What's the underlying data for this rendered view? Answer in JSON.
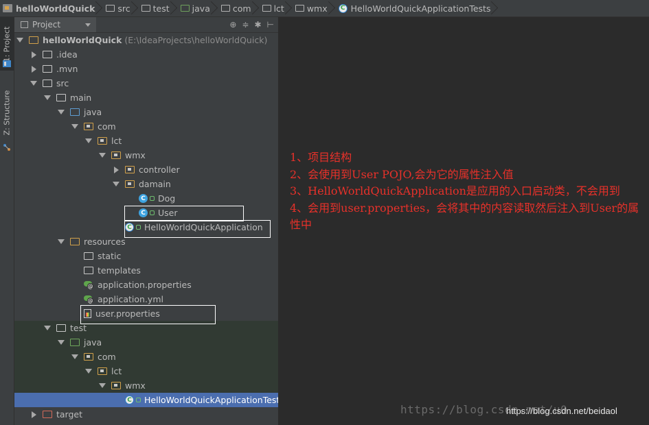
{
  "breadcrumbs": [
    "helloWorldQuick",
    "src",
    "test",
    "java",
    "com",
    "lct",
    "wmx",
    "HelloWorldQuickApplicationTests"
  ],
  "tool_windows": {
    "project_tab": "1: Project",
    "structure_tab": "Z: Structure"
  },
  "panel": {
    "title": "Project",
    "tool_icons": [
      "target-icon",
      "collapse-icon",
      "gear-icon",
      "hide-icon"
    ]
  },
  "tree": [
    {
      "label": "helloWorldQuick",
      "suffix": "(E:\\IdeaProjects\\helloWorldQuick)",
      "indent": 0,
      "arrow": "down",
      "icon": "project-folder-icon"
    },
    {
      "label": ".idea",
      "indent": 1,
      "arrow": "right",
      "icon": "folder-icon"
    },
    {
      "label": ".mvn",
      "indent": 1,
      "arrow": "right",
      "icon": "folder-icon"
    },
    {
      "label": "src",
      "indent": 1,
      "arrow": "down",
      "icon": "folder-icon"
    },
    {
      "label": "main",
      "indent": 2,
      "arrow": "down",
      "icon": "folder-icon"
    },
    {
      "label": "java",
      "indent": 3,
      "arrow": "down",
      "icon": "source-folder-icon"
    },
    {
      "label": "com",
      "indent": 4,
      "arrow": "down",
      "icon": "package-icon"
    },
    {
      "label": "lct",
      "indent": 5,
      "arrow": "down",
      "icon": "package-icon"
    },
    {
      "label": "wmx",
      "indent": 6,
      "arrow": "down",
      "icon": "package-icon"
    },
    {
      "label": "controller",
      "indent": 7,
      "arrow": "right",
      "icon": "package-icon"
    },
    {
      "label": "damain",
      "indent": 7,
      "arrow": "down",
      "icon": "package-icon"
    },
    {
      "label": "Dog",
      "indent": 8,
      "arrow": "none",
      "icon": "class-icon"
    },
    {
      "label": "User",
      "indent": 8,
      "arrow": "none",
      "icon": "class-icon"
    },
    {
      "label": "HelloWorldQuickApplication",
      "indent": 7,
      "arrow": "none",
      "icon": "spring-boot-class-icon"
    },
    {
      "label": "resources",
      "indent": 3,
      "arrow": "down",
      "icon": "resources-folder-icon"
    },
    {
      "label": "static",
      "indent": 4,
      "arrow": "none",
      "icon": "folder-icon"
    },
    {
      "label": "templates",
      "indent": 4,
      "arrow": "none",
      "icon": "folder-icon"
    },
    {
      "label": "application.properties",
      "indent": 4,
      "arrow": "none",
      "icon": "spring-config-icon"
    },
    {
      "label": "application.yml",
      "indent": 4,
      "arrow": "none",
      "icon": "spring-config-icon"
    },
    {
      "label": "user.properties",
      "indent": 4,
      "arrow": "none",
      "icon": "properties-file-icon"
    },
    {
      "label": "test",
      "indent": 2,
      "arrow": "down",
      "icon": "folder-icon"
    },
    {
      "label": "java",
      "indent": 3,
      "arrow": "down",
      "icon": "test-folder-icon"
    },
    {
      "label": "com",
      "indent": 4,
      "arrow": "down",
      "icon": "package-icon"
    },
    {
      "label": "lct",
      "indent": 5,
      "arrow": "down",
      "icon": "package-icon"
    },
    {
      "label": "wmx",
      "indent": 6,
      "arrow": "down",
      "icon": "package-icon"
    },
    {
      "label": "HelloWorldQuickApplicationTests",
      "indent": 7,
      "arrow": "none",
      "icon": "spring-boot-test-icon",
      "selected": true
    },
    {
      "label": "target",
      "indent": 1,
      "arrow": "right",
      "icon": "excluded-folder-icon"
    }
  ],
  "notes": [
    "1、项目结构",
    "2、会使用到User POJO,会为它的属性注入值",
    "3、HelloWorldQuickApplication是应用的入口启动类，不会用到",
    "4、会用到user.properties，会将其中的内容读取然后注入到User的属性中"
  ],
  "watermark": "https://blog.csdn.net/u0",
  "watermark_overlay": "https://blog.csdn.net/beidaol",
  "colors": {
    "selection": "#4b6eaf",
    "note_text": "#e8312a",
    "class_icon": "#3ea3e0"
  }
}
